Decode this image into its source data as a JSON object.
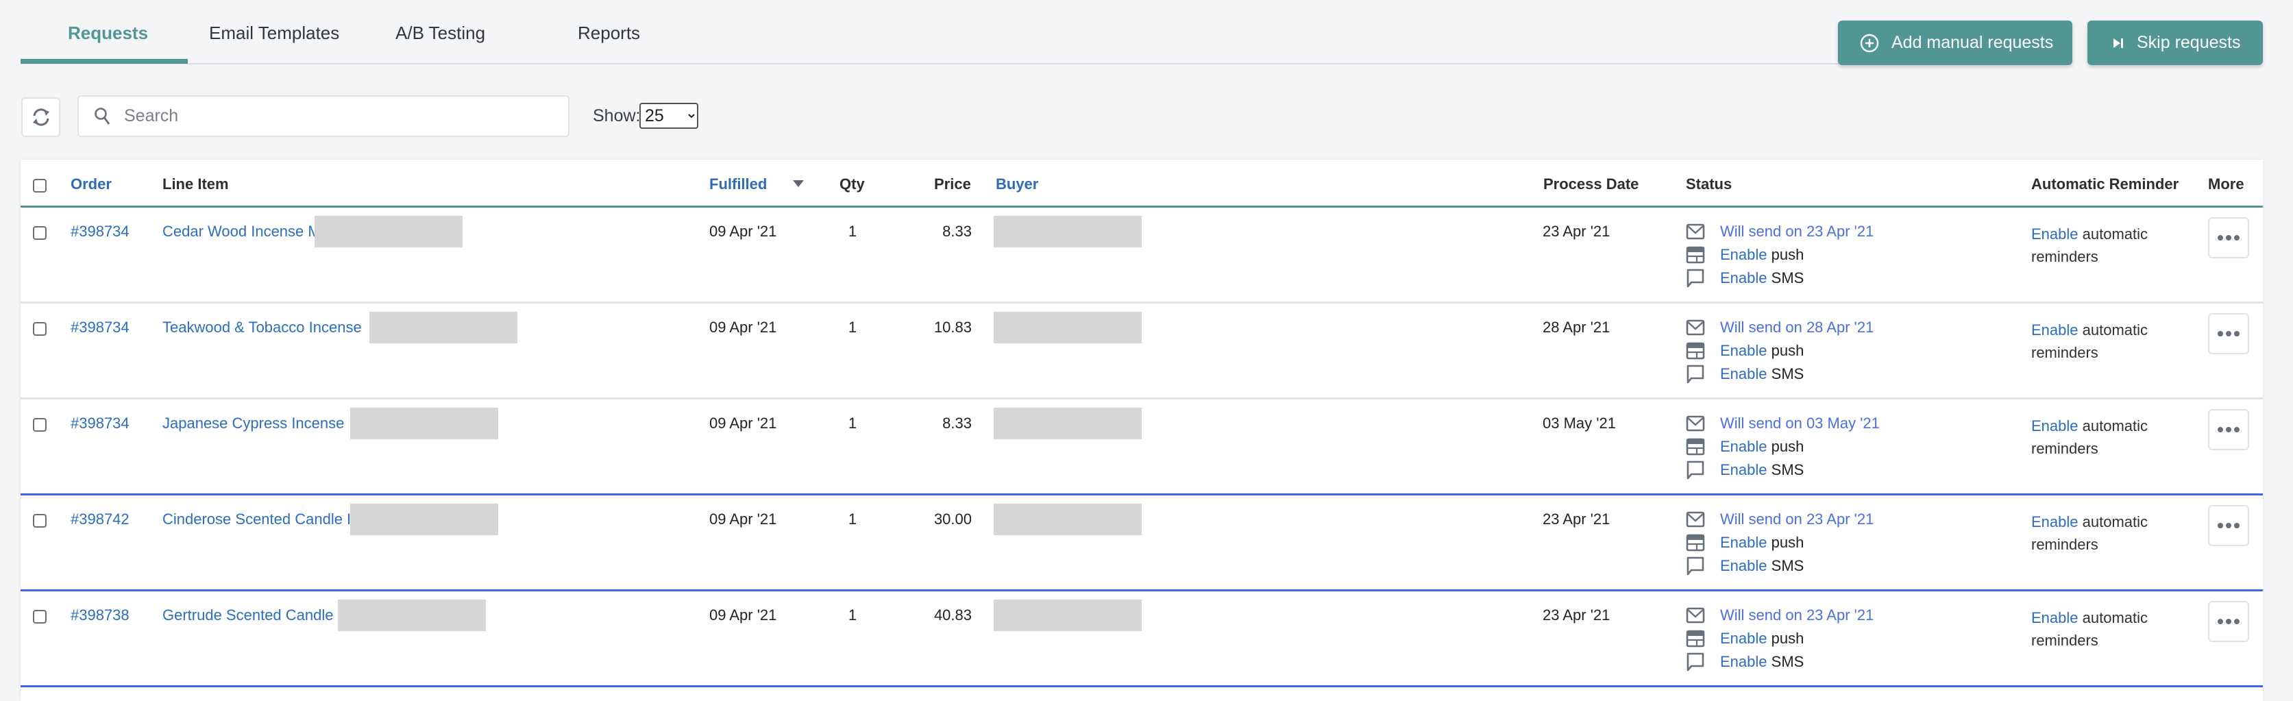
{
  "tabs": [
    {
      "label": "Requests",
      "active": true
    },
    {
      "label": "Email Templates",
      "active": false
    },
    {
      "label": "A/B Testing",
      "active": false
    },
    {
      "label": "Reports",
      "active": false
    }
  ],
  "actions": {
    "add_manual": {
      "label": "Add manual requests",
      "icon": "plus-circle-icon"
    },
    "skip": {
      "label": "Skip requests",
      "icon": "skip-forward-icon"
    }
  },
  "toolbar": {
    "refresh_icon": "refresh-icon",
    "search": {
      "placeholder": "Search",
      "value": ""
    },
    "show_label": "Show:",
    "show_value": "25"
  },
  "colors": {
    "accent": "#529694",
    "link": "#2c6dbf",
    "status_link": "#4a6fe0",
    "group_border": "#4364e8",
    "row_border": "#e2e3e5",
    "redacted": "#d6d6d6"
  },
  "table": {
    "columns": {
      "order": "Order",
      "line_item": "Line Item",
      "fulfilled": "Fulfilled",
      "qty": "Qty",
      "price": "Price",
      "buyer": "Buyer",
      "process_date": "Process Date",
      "status": "Status",
      "automatic_reminder": "Automatic Reminder",
      "more": "More"
    },
    "sort": {
      "column": "Fulfilled",
      "direction": "descending"
    },
    "rows": [
      {
        "order": "#398734",
        "line_item": "Cedar Wood Incense M",
        "fulfilled": "09 Apr '21",
        "qty": "1",
        "price": "8.33",
        "buyer": "",
        "process_date": "23 Apr '21",
        "email_status": "Will send on 23 Apr '21",
        "push_link": "Enable",
        "push_text": "push",
        "sms_link": "Enable",
        "sms_text": "SMS",
        "reminder_link": "Enable",
        "reminder_text": "automatic reminders",
        "group_end": false
      },
      {
        "order": "#398734",
        "line_item": "Teakwood & Tobacco Incense",
        "fulfilled": "09 Apr '21",
        "qty": "1",
        "price": "10.83",
        "buyer": "",
        "process_date": "28 Apr '21",
        "email_status": "Will send on 28 Apr '21",
        "push_link": "Enable",
        "push_text": "push",
        "sms_link": "Enable",
        "sms_text": "SMS",
        "reminder_link": "Enable",
        "reminder_text": "automatic reminders",
        "group_end": false
      },
      {
        "order": "#398734",
        "line_item": "Japanese Cypress Incense",
        "fulfilled": "09 Apr '21",
        "qty": "1",
        "price": "8.33",
        "buyer": "",
        "process_date": "03 May '21",
        "email_status": "Will send on 03 May '21",
        "push_link": "Enable",
        "push_text": "push",
        "sms_link": "Enable",
        "sms_text": "SMS",
        "reminder_link": "Enable",
        "reminder_text": "automatic reminders",
        "group_end": true
      },
      {
        "order": "#398742",
        "line_item": "Cinderose Scented Candle I",
        "fulfilled": "09 Apr '21",
        "qty": "1",
        "price": "30.00",
        "buyer": "",
        "process_date": "23 Apr '21",
        "email_status": "Will send on 23 Apr '21",
        "push_link": "Enable",
        "push_text": "push",
        "sms_link": "Enable",
        "sms_text": "SMS",
        "reminder_link": "Enable",
        "reminder_text": "automatic reminders",
        "group_end": true
      },
      {
        "order": "#398738",
        "line_item": "Gertrude Scented Candle",
        "fulfilled": "09 Apr '21",
        "qty": "1",
        "price": "40.83",
        "buyer": "",
        "process_date": "23 Apr '21",
        "email_status": "Will send on 23 Apr '21",
        "push_link": "Enable",
        "push_text": "push",
        "sms_link": "Enable",
        "sms_text": "SMS",
        "reminder_link": "Enable",
        "reminder_text": "automatic reminders",
        "group_end": true
      }
    ]
  }
}
